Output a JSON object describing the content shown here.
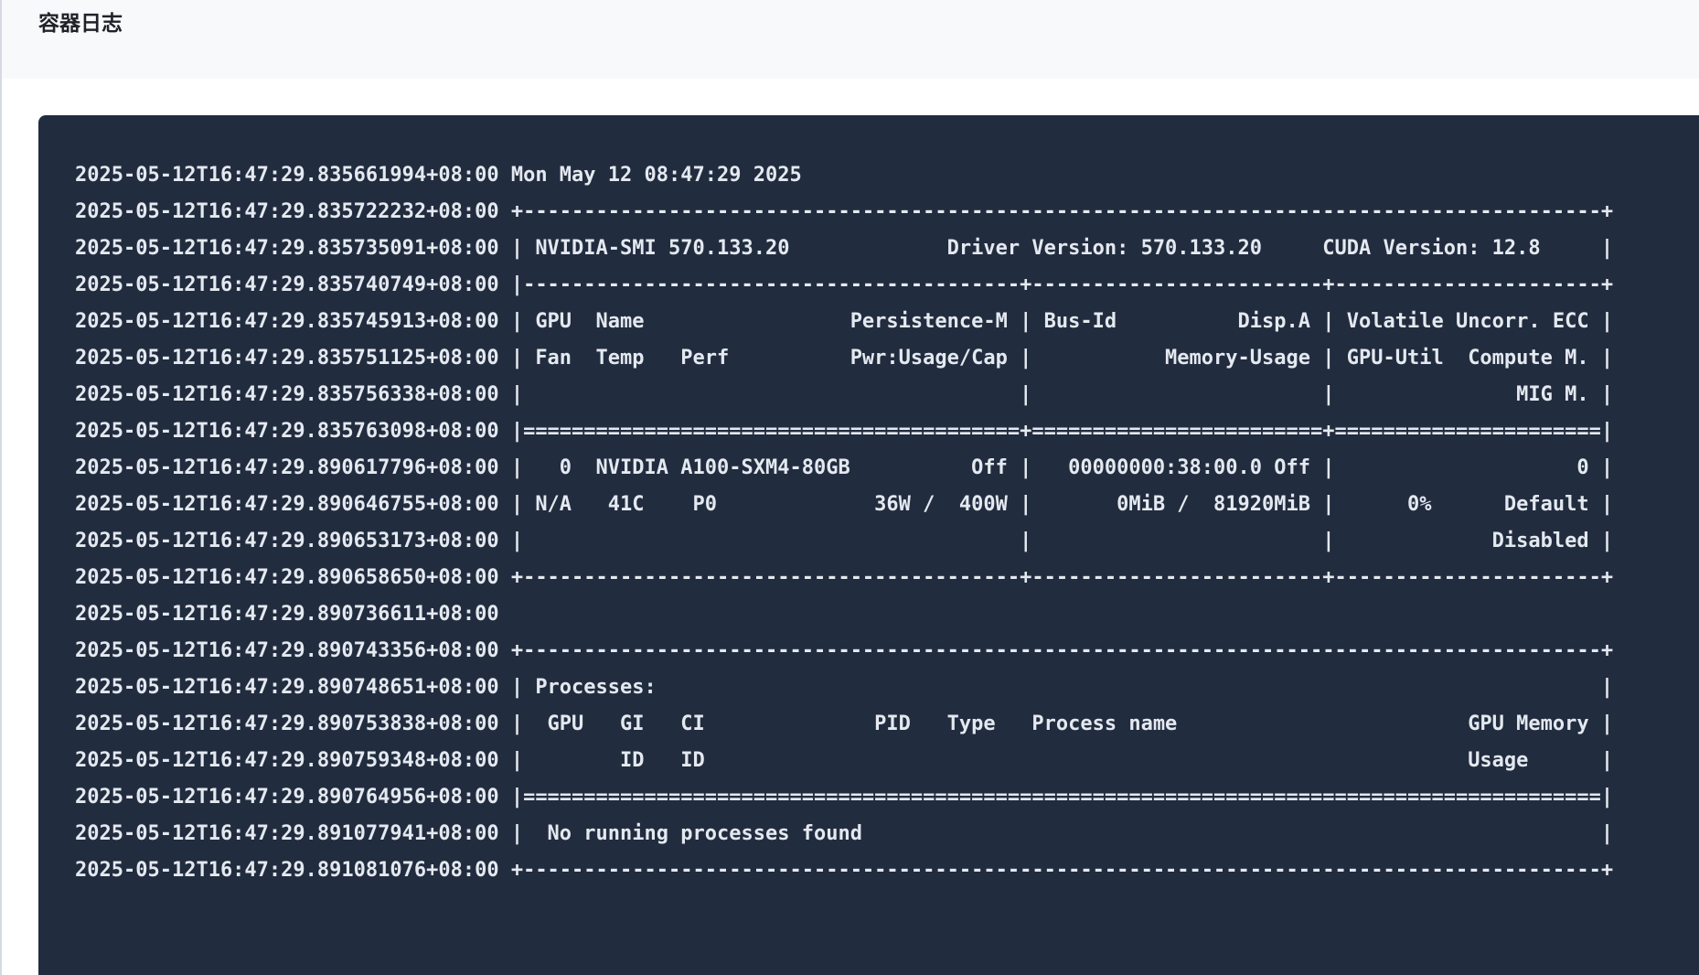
{
  "page": {
    "title": "容器日志"
  },
  "colors": {
    "header_bg": "#f8f9fb",
    "log_bg": "#222c3f",
    "log_text": "#e4e9f0",
    "title_text": "#1f2329"
  },
  "log": {
    "lines": [
      "2025-05-12T16:47:29.835661994+08:00 Mon May 12 08:47:29 2025",
      "2025-05-12T16:47:29.835722232+08:00 +-----------------------------------------------------------------------------------------+",
      "2025-05-12T16:47:29.835735091+08:00 | NVIDIA-SMI 570.133.20             Driver Version: 570.133.20     CUDA Version: 12.8     |",
      "2025-05-12T16:47:29.835740749+08:00 |-----------------------------------------+------------------------+----------------------+",
      "2025-05-12T16:47:29.835745913+08:00 | GPU  Name                 Persistence-M | Bus-Id          Disp.A | Volatile Uncorr. ECC |",
      "2025-05-12T16:47:29.835751125+08:00 | Fan  Temp   Perf          Pwr:Usage/Cap |           Memory-Usage | GPU-Util  Compute M. |",
      "2025-05-12T16:47:29.835756338+08:00 |                                         |                        |               MIG M. |",
      "2025-05-12T16:47:29.835763098+08:00 |=========================================+========================+======================|",
      "2025-05-12T16:47:29.890617796+08:00 |   0  NVIDIA A100-SXM4-80GB          Off |   00000000:38:00.0 Off |                    0 |",
      "2025-05-12T16:47:29.890646755+08:00 | N/A   41C    P0             36W /  400W |       0MiB /  81920MiB |      0%      Default |",
      "2025-05-12T16:47:29.890653173+08:00 |                                         |                        |             Disabled |",
      "2025-05-12T16:47:29.890658650+08:00 +-----------------------------------------+------------------------+----------------------+",
      "2025-05-12T16:47:29.890736611+08:00",
      "2025-05-12T16:47:29.890743356+08:00 +-----------------------------------------------------------------------------------------+",
      "2025-05-12T16:47:29.890748651+08:00 | Processes:                                                                              |",
      "2025-05-12T16:47:29.890753838+08:00 |  GPU   GI   CI              PID   Type   Process name                        GPU Memory |",
      "2025-05-12T16:47:29.890759348+08:00 |        ID   ID                                                               Usage      |",
      "2025-05-12T16:47:29.890764956+08:00 |=========================================================================================|",
      "2025-05-12T16:47:29.891077941+08:00 |  No running processes found                                                             |",
      "2025-05-12T16:47:29.891081076+08:00 +-----------------------------------------------------------------------------------------+"
    ]
  }
}
